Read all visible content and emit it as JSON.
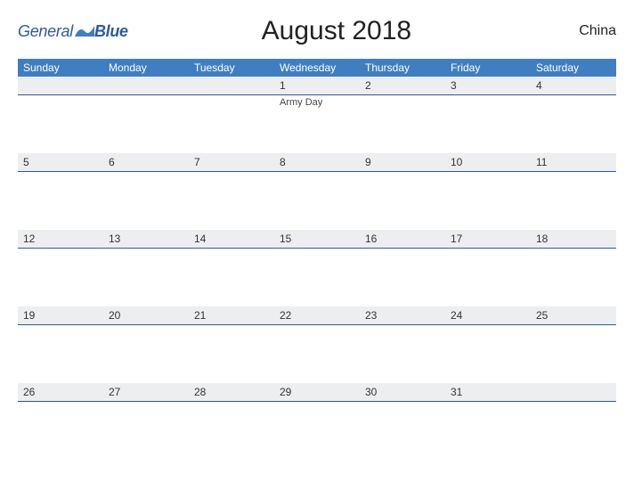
{
  "brand": {
    "text1": "General",
    "text2": "Blue"
  },
  "title": "August 2018",
  "country": "China",
  "days_of_week": [
    "Sunday",
    "Monday",
    "Tuesday",
    "Wednesday",
    "Thursday",
    "Friday",
    "Saturday"
  ],
  "weeks": [
    {
      "nums": [
        "",
        "",
        "",
        "1",
        "2",
        "3",
        "4"
      ],
      "events": [
        "",
        "",
        "",
        "Army Day",
        "",
        "",
        ""
      ]
    },
    {
      "nums": [
        "5",
        "6",
        "7",
        "8",
        "9",
        "10",
        "11"
      ],
      "events": [
        "",
        "",
        "",
        "",
        "",
        "",
        ""
      ]
    },
    {
      "nums": [
        "12",
        "13",
        "14",
        "15",
        "16",
        "17",
        "18"
      ],
      "events": [
        "",
        "",
        "",
        "",
        "",
        "",
        ""
      ]
    },
    {
      "nums": [
        "19",
        "20",
        "21",
        "22",
        "23",
        "24",
        "25"
      ],
      "events": [
        "",
        "",
        "",
        "",
        "",
        "",
        ""
      ]
    },
    {
      "nums": [
        "26",
        "27",
        "28",
        "29",
        "30",
        "31",
        ""
      ],
      "events": [
        "",
        "",
        "",
        "",
        "",
        "",
        ""
      ]
    }
  ]
}
